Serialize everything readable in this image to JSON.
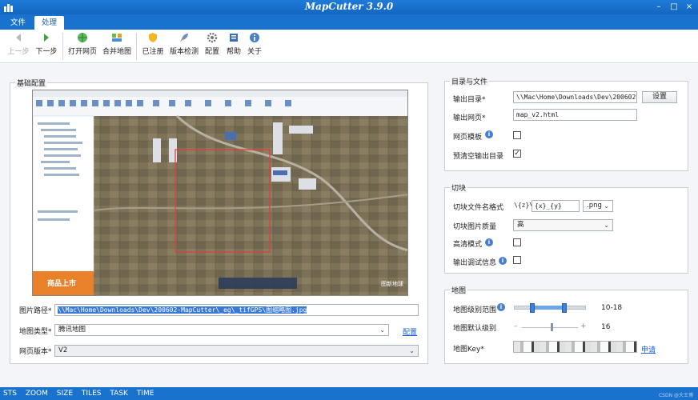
{
  "app": {
    "title": "MapCutter 3.9.0"
  },
  "window": {
    "minimize": "–",
    "maximize": "□",
    "close": "×"
  },
  "tabs": [
    {
      "label": "文件"
    },
    {
      "label": "处理"
    }
  ],
  "toolbar": {
    "prev": "上一步",
    "next": "下一步",
    "open_web": "打开网页",
    "merge_map": "合并地图",
    "registered": "已注册",
    "version_check": "版本检测",
    "config": "配置",
    "help": "帮助",
    "about": "关于"
  },
  "basic": {
    "title": "基础配置",
    "image_path_label": "图片路径*",
    "image_path_value": "\\\\Mac\\Home\\Downloads\\Dev\\200602-MapCutter\\_eg\\_tifGPS\\图缩略图.jpg",
    "map_type_label": "地图类型*",
    "map_type_value": "腾讯地图",
    "config_link": "配置",
    "web_version_label": "网页版本*",
    "web_version_value": "V2",
    "preview_ad_text": "商品上市",
    "preview_watermark": "图新地球"
  },
  "output": {
    "title": "目录与文件",
    "dir_label": "输出目录*",
    "dir_value": "\\\\Mac\\Home\\Downloads\\Dev\\200602-MapC",
    "set_button": "设置",
    "web_label": "输出网页*",
    "web_value": "map_v2.html",
    "template_label": "网页模板",
    "preclear_label": "预清空输出目录",
    "template_checked": false,
    "preclear_checked": true
  },
  "tiles": {
    "title": "切块",
    "name_format_label": "切块文件名格式",
    "name_prefix": "\\{z}\\",
    "name_value": "{x}_{y}",
    "ext_value": ".png",
    "quality_label": "切块图片质量",
    "quality_value": "高",
    "hd_label": "高清模式",
    "debug_label": "输出调试信息",
    "hd_checked": false,
    "debug_checked": false
  },
  "map": {
    "title": "地图",
    "level_range_label": "地图级别范围",
    "level_range_value": "10-18",
    "level_range_min": 10,
    "level_range_max": 18,
    "default_level_label": "地图默认级别",
    "default_level_value": "16",
    "default_level": 16,
    "key_label": "地图Key*",
    "apply_link": "申请"
  },
  "statusbar": {
    "items": [
      "STS",
      "ZOOM",
      "SIZE",
      "TILES",
      "TASK",
      "TIME"
    ],
    "watermark": "CSDN @大王博"
  },
  "colors": {
    "titlebar": "#1a72cf",
    "accent": "#1a5fd0"
  }
}
